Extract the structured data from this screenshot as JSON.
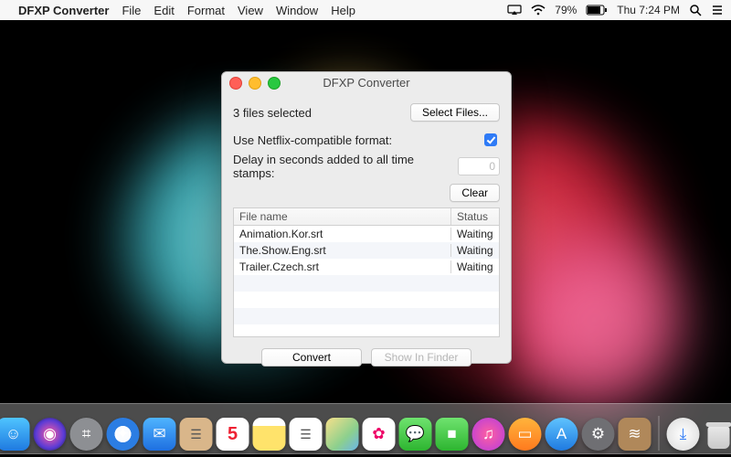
{
  "menubar": {
    "app_name": "DFXP Converter",
    "items": [
      "File",
      "Edit",
      "Format",
      "View",
      "Window",
      "Help"
    ],
    "battery_pct": "79%",
    "clock": "Thu 7:24 PM"
  },
  "window": {
    "title": "DFXP Converter",
    "files_selected_label": "3 files selected",
    "select_files_btn": "Select Files...",
    "netflix_label": "Use Netflix-compatible format:",
    "netflix_checked": true,
    "delay_label": "Delay in seconds added to all time stamps:",
    "delay_value": "0",
    "clear_btn": "Clear",
    "table": {
      "headers": {
        "name": "File name",
        "status": "Status"
      },
      "rows": [
        {
          "name": "Animation.Kor.srt",
          "status": "Waiting"
        },
        {
          "name": "The.Show.Eng.srt",
          "status": "Waiting"
        },
        {
          "name": "Trailer.Czech.srt",
          "status": "Waiting"
        }
      ]
    },
    "convert_btn": "Convert",
    "show_in_finder_btn": "Show In Finder"
  },
  "dock": {
    "items": [
      {
        "name": "finder",
        "bg": "linear-gradient(#4fc4ff,#1f7ae0)",
        "glyph": "☺"
      },
      {
        "name": "siri",
        "bg": "radial-gradient(circle at 50% 50%,#ff5ea0,#5a3bd6 60%,#101020)",
        "glyph": "◉",
        "round": true
      },
      {
        "name": "launchpad",
        "bg": "#8d8f93",
        "glyph": "⌗",
        "round": true
      },
      {
        "name": "safari",
        "bg": "radial-gradient(circle,#fafcff 35%,#2b7de3 36%)",
        "glyph": "✦",
        "round": true
      },
      {
        "name": "mail",
        "bg": "linear-gradient(#4fb4ff,#1e6fe0)",
        "glyph": "✉"
      },
      {
        "name": "contacts",
        "bg": "#d9b68a",
        "glyph": "☰"
      },
      {
        "name": "calendar",
        "bg": "#fff",
        "glyph": "5"
      },
      {
        "name": "notes",
        "bg": "linear-gradient(#fff,#fff 25%,#ffe36b 25%)",
        "glyph": ""
      },
      {
        "name": "reminders",
        "bg": "#fff",
        "glyph": "☰"
      },
      {
        "name": "maps",
        "bg": "linear-gradient(135deg,#f7e08a,#8dd08d 60%,#6bb5e8)",
        "glyph": ""
      },
      {
        "name": "photos",
        "bg": "#fff",
        "glyph": "✿"
      },
      {
        "name": "messages",
        "bg": "linear-gradient(#6fe36f,#2db530)",
        "glyph": "💬"
      },
      {
        "name": "facetime",
        "bg": "linear-gradient(#6fe36f,#2db530)",
        "glyph": "■"
      },
      {
        "name": "itunes",
        "bg": "radial-gradient(circle,#ff5fa0,#b43be0)",
        "glyph": "♫",
        "round": true
      },
      {
        "name": "ibooks",
        "bg": "linear-gradient(#ffb43c,#ff7a1e)",
        "glyph": "▭",
        "round": true
      },
      {
        "name": "appstore",
        "bg": "linear-gradient(#5fc3ff,#1f7ae0)",
        "glyph": "A",
        "round": true
      },
      {
        "name": "preferences",
        "bg": "#6f6f73",
        "glyph": "⚙",
        "round": true
      },
      {
        "name": "dfxp-converter",
        "bg": "#b0885a",
        "glyph": "≋"
      }
    ],
    "downloads_name": "downloads"
  }
}
